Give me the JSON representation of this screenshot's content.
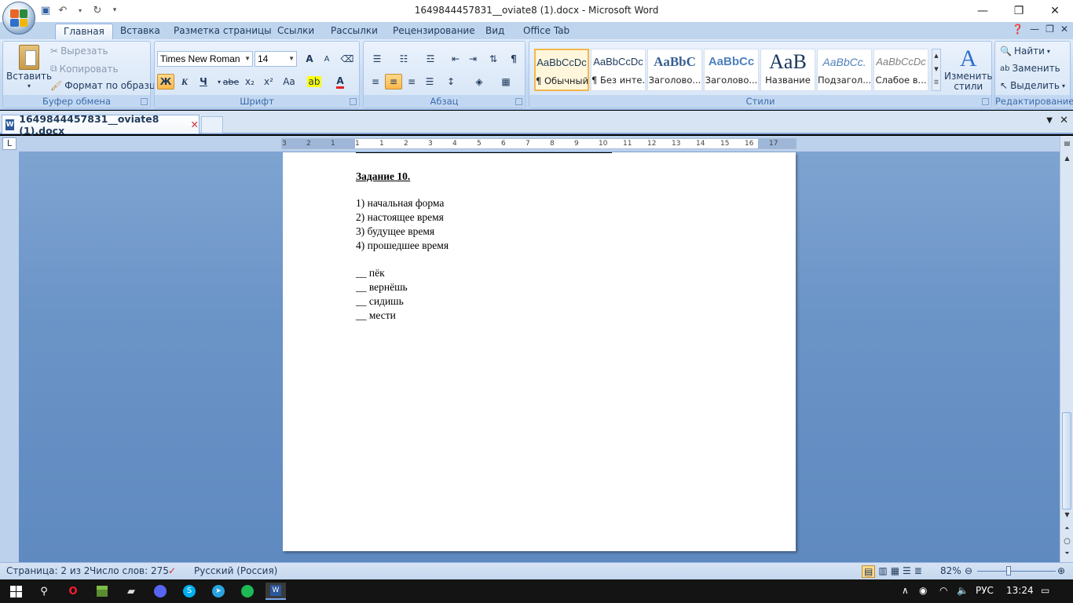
{
  "window": {
    "title": "1649844457831__oviate8 (1).docx - Microsoft Word",
    "qat": {
      "save_icon": "save-icon",
      "undo_icon": "undo-icon",
      "redo_icon": "redo-icon",
      "customize_icon": "customize-qat-icon"
    }
  },
  "ribbon_tabs": [
    "Главная",
    "Вставка",
    "Разметка страницы",
    "Ссылки",
    "Рассылки",
    "Рецензирование",
    "Вид",
    "Office Tab"
  ],
  "clipboard": {
    "paste": "Вставить",
    "cut": "Вырезать",
    "copy": "Копировать",
    "format_painter": "Формат по образцу",
    "label": "Буфер обмена"
  },
  "font": {
    "name": "Times New Roman",
    "size": "14",
    "grow": "A",
    "shrink": "A",
    "bold": "Ж",
    "italic": "К",
    "underline": "Ч",
    "strike": "abe",
    "subscript": "x₂",
    "superscript": "x²",
    "case": "Aa",
    "label": "Шрифт"
  },
  "paragraph": {
    "label": "Абзац"
  },
  "styles": {
    "items": [
      {
        "preview": "AaBbCcDc",
        "name": "¶ Обычный"
      },
      {
        "preview": "AaBbCcDc",
        "name": "¶ Без инте..."
      },
      {
        "preview": "AaBbC",
        "name": "Заголово..."
      },
      {
        "preview": "AaBbCc",
        "name": "Заголово..."
      },
      {
        "preview": "AaB",
        "name": "Название"
      },
      {
        "preview": "AaBbCc.",
        "name": "Подзагол..."
      },
      {
        "preview": "AaBbCcDc",
        "name": "Слабое в..."
      }
    ],
    "change_styles_line1": "Изменить",
    "change_styles_line2": "стили",
    "label": "Стили"
  },
  "editing": {
    "find": "Найти",
    "replace": "Заменить",
    "select": "Выделить",
    "label": "Редактирование"
  },
  "doc_tab": {
    "name": "1649844457831__oviate8 (1).docx"
  },
  "ruler_labels": [
    "3",
    "2",
    "1",
    "1",
    "1",
    "2",
    "3",
    "4",
    "5",
    "6",
    "7",
    "8",
    "9",
    "10",
    "11",
    "12",
    "13",
    "14",
    "15",
    "16",
    "17"
  ],
  "document": {
    "heading": "Задание 10.",
    "list": [
      "1) начальная форма",
      "2) настоящее время",
      "3) будущее время",
      "4) прошедшее время"
    ],
    "blanks": [
      "__ пёк",
      "__ вернёшь",
      "__ сидишь",
      "__ мести"
    ]
  },
  "status": {
    "page": "Страница: 2 из 2",
    "words": "Число слов: 275",
    "language": "Русский (Россия)",
    "zoom": "82%"
  },
  "taskbar": {
    "lang": "РУС",
    "time": "13:24"
  }
}
